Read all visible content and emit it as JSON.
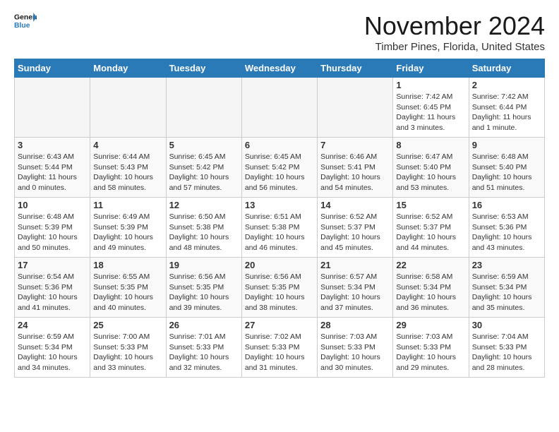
{
  "header": {
    "logo_line1": "General",
    "logo_line2": "Blue",
    "month": "November 2024",
    "location": "Timber Pines, Florida, United States"
  },
  "weekdays": [
    "Sunday",
    "Monday",
    "Tuesday",
    "Wednesday",
    "Thursday",
    "Friday",
    "Saturday"
  ],
  "weeks": [
    [
      {
        "day": "",
        "empty": true
      },
      {
        "day": "",
        "empty": true
      },
      {
        "day": "",
        "empty": true
      },
      {
        "day": "",
        "empty": true
      },
      {
        "day": "",
        "empty": true
      },
      {
        "day": "1",
        "sunrise": "Sunrise: 7:42 AM",
        "sunset": "Sunset: 6:45 PM",
        "daylight": "Daylight: 11 hours and 3 minutes."
      },
      {
        "day": "2",
        "sunrise": "Sunrise: 7:42 AM",
        "sunset": "Sunset: 6:44 PM",
        "daylight": "Daylight: 11 hours and 1 minute."
      }
    ],
    [
      {
        "day": "3",
        "sunrise": "Sunrise: 6:43 AM",
        "sunset": "Sunset: 5:44 PM",
        "daylight": "Daylight: 11 hours and 0 minutes."
      },
      {
        "day": "4",
        "sunrise": "Sunrise: 6:44 AM",
        "sunset": "Sunset: 5:43 PM",
        "daylight": "Daylight: 10 hours and 58 minutes."
      },
      {
        "day": "5",
        "sunrise": "Sunrise: 6:45 AM",
        "sunset": "Sunset: 5:42 PM",
        "daylight": "Daylight: 10 hours and 57 minutes."
      },
      {
        "day": "6",
        "sunrise": "Sunrise: 6:45 AM",
        "sunset": "Sunset: 5:42 PM",
        "daylight": "Daylight: 10 hours and 56 minutes."
      },
      {
        "day": "7",
        "sunrise": "Sunrise: 6:46 AM",
        "sunset": "Sunset: 5:41 PM",
        "daylight": "Daylight: 10 hours and 54 minutes."
      },
      {
        "day": "8",
        "sunrise": "Sunrise: 6:47 AM",
        "sunset": "Sunset: 5:40 PM",
        "daylight": "Daylight: 10 hours and 53 minutes."
      },
      {
        "day": "9",
        "sunrise": "Sunrise: 6:48 AM",
        "sunset": "Sunset: 5:40 PM",
        "daylight": "Daylight: 10 hours and 51 minutes."
      }
    ],
    [
      {
        "day": "10",
        "sunrise": "Sunrise: 6:48 AM",
        "sunset": "Sunset: 5:39 PM",
        "daylight": "Daylight: 10 hours and 50 minutes."
      },
      {
        "day": "11",
        "sunrise": "Sunrise: 6:49 AM",
        "sunset": "Sunset: 5:39 PM",
        "daylight": "Daylight: 10 hours and 49 minutes."
      },
      {
        "day": "12",
        "sunrise": "Sunrise: 6:50 AM",
        "sunset": "Sunset: 5:38 PM",
        "daylight": "Daylight: 10 hours and 48 minutes."
      },
      {
        "day": "13",
        "sunrise": "Sunrise: 6:51 AM",
        "sunset": "Sunset: 5:38 PM",
        "daylight": "Daylight: 10 hours and 46 minutes."
      },
      {
        "day": "14",
        "sunrise": "Sunrise: 6:52 AM",
        "sunset": "Sunset: 5:37 PM",
        "daylight": "Daylight: 10 hours and 45 minutes."
      },
      {
        "day": "15",
        "sunrise": "Sunrise: 6:52 AM",
        "sunset": "Sunset: 5:37 PM",
        "daylight": "Daylight: 10 hours and 44 minutes."
      },
      {
        "day": "16",
        "sunrise": "Sunrise: 6:53 AM",
        "sunset": "Sunset: 5:36 PM",
        "daylight": "Daylight: 10 hours and 43 minutes."
      }
    ],
    [
      {
        "day": "17",
        "sunrise": "Sunrise: 6:54 AM",
        "sunset": "Sunset: 5:36 PM",
        "daylight": "Daylight: 10 hours and 41 minutes."
      },
      {
        "day": "18",
        "sunrise": "Sunrise: 6:55 AM",
        "sunset": "Sunset: 5:35 PM",
        "daylight": "Daylight: 10 hours and 40 minutes."
      },
      {
        "day": "19",
        "sunrise": "Sunrise: 6:56 AM",
        "sunset": "Sunset: 5:35 PM",
        "daylight": "Daylight: 10 hours and 39 minutes."
      },
      {
        "day": "20",
        "sunrise": "Sunrise: 6:56 AM",
        "sunset": "Sunset: 5:35 PM",
        "daylight": "Daylight: 10 hours and 38 minutes."
      },
      {
        "day": "21",
        "sunrise": "Sunrise: 6:57 AM",
        "sunset": "Sunset: 5:34 PM",
        "daylight": "Daylight: 10 hours and 37 minutes."
      },
      {
        "day": "22",
        "sunrise": "Sunrise: 6:58 AM",
        "sunset": "Sunset: 5:34 PM",
        "daylight": "Daylight: 10 hours and 36 minutes."
      },
      {
        "day": "23",
        "sunrise": "Sunrise: 6:59 AM",
        "sunset": "Sunset: 5:34 PM",
        "daylight": "Daylight: 10 hours and 35 minutes."
      }
    ],
    [
      {
        "day": "24",
        "sunrise": "Sunrise: 6:59 AM",
        "sunset": "Sunset: 5:34 PM",
        "daylight": "Daylight: 10 hours and 34 minutes."
      },
      {
        "day": "25",
        "sunrise": "Sunrise: 7:00 AM",
        "sunset": "Sunset: 5:33 PM",
        "daylight": "Daylight: 10 hours and 33 minutes."
      },
      {
        "day": "26",
        "sunrise": "Sunrise: 7:01 AM",
        "sunset": "Sunset: 5:33 PM",
        "daylight": "Daylight: 10 hours and 32 minutes."
      },
      {
        "day": "27",
        "sunrise": "Sunrise: 7:02 AM",
        "sunset": "Sunset: 5:33 PM",
        "daylight": "Daylight: 10 hours and 31 minutes."
      },
      {
        "day": "28",
        "sunrise": "Sunrise: 7:03 AM",
        "sunset": "Sunset: 5:33 PM",
        "daylight": "Daylight: 10 hours and 30 minutes."
      },
      {
        "day": "29",
        "sunrise": "Sunrise: 7:03 AM",
        "sunset": "Sunset: 5:33 PM",
        "daylight": "Daylight: 10 hours and 29 minutes."
      },
      {
        "day": "30",
        "sunrise": "Sunrise: 7:04 AM",
        "sunset": "Sunset: 5:33 PM",
        "daylight": "Daylight: 10 hours and 28 minutes."
      }
    ]
  ]
}
